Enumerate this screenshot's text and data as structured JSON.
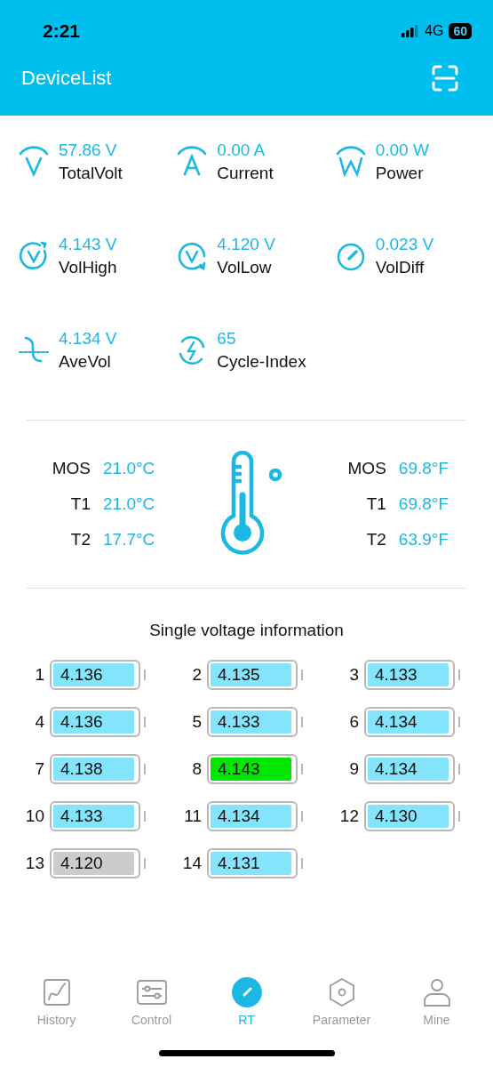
{
  "status_bar": {
    "time": "2:21",
    "network": "4G",
    "battery": "60"
  },
  "header": {
    "title": "DeviceList"
  },
  "metrics": [
    {
      "kind": "volt",
      "value": "57.86 V",
      "label": "TotalVolt"
    },
    {
      "kind": "amp",
      "value": "0.00 A",
      "label": "Current"
    },
    {
      "kind": "watt",
      "value": "0.00 W",
      "label": "Power"
    },
    {
      "kind": "high",
      "value": "4.143 V",
      "label": "VolHigh"
    },
    {
      "kind": "low",
      "value": "4.120 V",
      "label": "VolLow"
    },
    {
      "kind": "diff",
      "value": "0.023 V",
      "label": "VolDiff"
    },
    {
      "kind": "avg",
      "value": "4.134 V",
      "label": "AveVol"
    },
    {
      "kind": "cycle",
      "value": "65",
      "label": "Cycle-Index"
    }
  ],
  "temps_c": [
    {
      "label": "MOS",
      "value": "21.0°C"
    },
    {
      "label": "T1",
      "value": "21.0°C"
    },
    {
      "label": "T2",
      "value": "17.7°C"
    }
  ],
  "temps_f": [
    {
      "label": "MOS",
      "value": "69.8°F"
    },
    {
      "label": "T1",
      "value": "69.8°F"
    },
    {
      "label": "T2",
      "value": "63.9°F"
    }
  ],
  "cells_title": "Single voltage information",
  "cells": [
    {
      "index": "1",
      "voltage": "4.136",
      "color": "#84e4fb"
    },
    {
      "index": "2",
      "voltage": "4.135",
      "color": "#84e4fb"
    },
    {
      "index": "3",
      "voltage": "4.133",
      "color": "#84e4fb"
    },
    {
      "index": "4",
      "voltage": "4.136",
      "color": "#84e4fb"
    },
    {
      "index": "5",
      "voltage": "4.133",
      "color": "#84e4fb"
    },
    {
      "index": "6",
      "voltage": "4.134",
      "color": "#84e4fb"
    },
    {
      "index": "7",
      "voltage": "4.138",
      "color": "#84e4fb"
    },
    {
      "index": "8",
      "voltage": "4.143",
      "color": "#00e600"
    },
    {
      "index": "9",
      "voltage": "4.134",
      "color": "#84e4fb"
    },
    {
      "index": "10",
      "voltage": "4.133",
      "color": "#84e4fb"
    },
    {
      "index": "11",
      "voltage": "4.134",
      "color": "#84e4fb"
    },
    {
      "index": "12",
      "voltage": "4.130",
      "color": "#84e4fb"
    },
    {
      "index": "13",
      "voltage": "4.120",
      "color": "#cccccc"
    },
    {
      "index": "14",
      "voltage": "4.131",
      "color": "#84e4fb"
    }
  ],
  "tabs": [
    {
      "kind": "history",
      "label": "History",
      "selected": false
    },
    {
      "kind": "control",
      "label": "Control",
      "selected": false
    },
    {
      "kind": "rt",
      "label": "RT",
      "selected": true
    },
    {
      "kind": "parameter",
      "label": "Parameter",
      "selected": false
    },
    {
      "kind": "mine",
      "label": "Mine",
      "selected": false
    }
  ]
}
